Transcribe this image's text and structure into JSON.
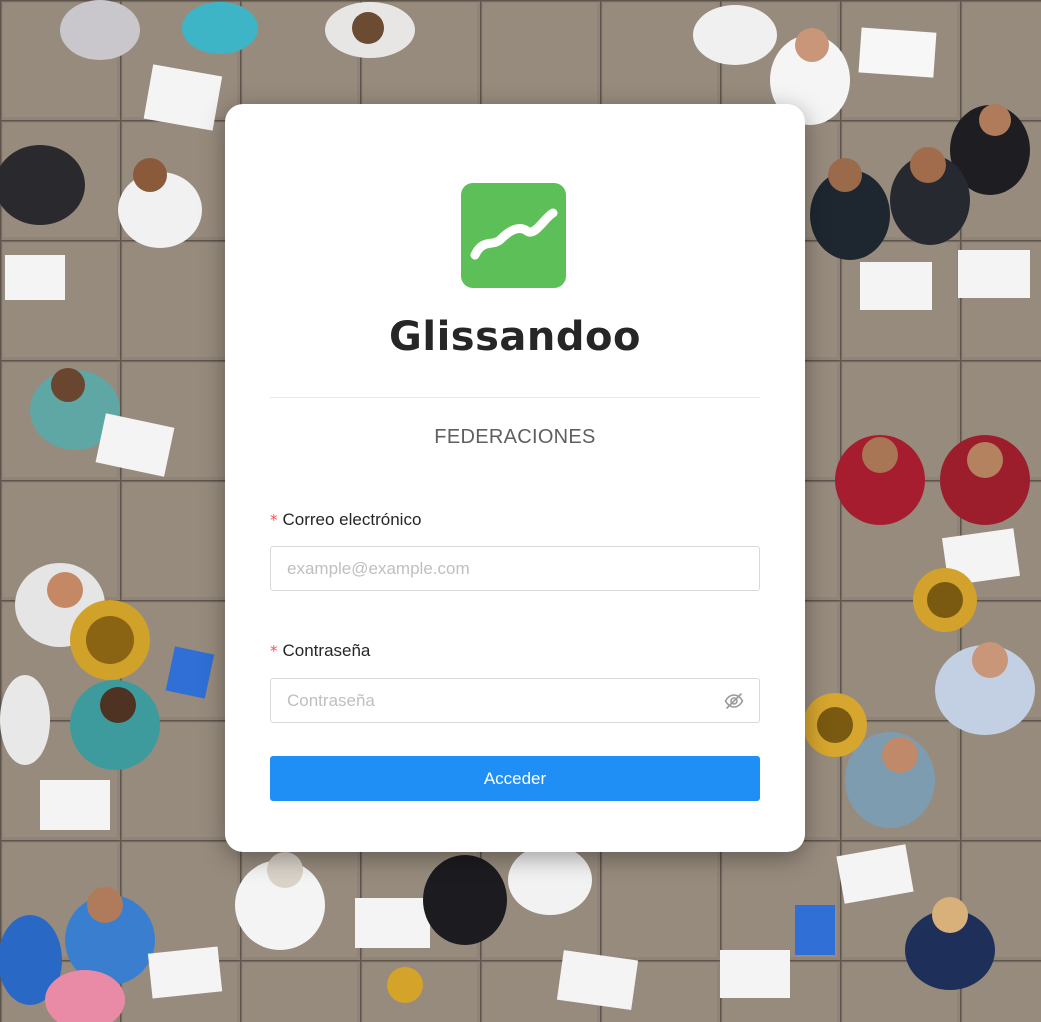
{
  "app": {
    "name": "Glissandoo",
    "logo_icon": "wave-logo-icon",
    "brand_color": "#5dbf57"
  },
  "login": {
    "section_title": "FEDERACIONES",
    "required_marker": "*",
    "email": {
      "label": "Correo electrónico",
      "value": "",
      "placeholder": "example@example.com"
    },
    "password": {
      "label": "Contraseña",
      "value": "",
      "placeholder": "Contraseña",
      "visibility_icon": "eye-slash-icon"
    },
    "submit_label": "Acceder",
    "accent_color": "#1f8ff5"
  },
  "background": {
    "description_icon": "brass-band-photo"
  }
}
